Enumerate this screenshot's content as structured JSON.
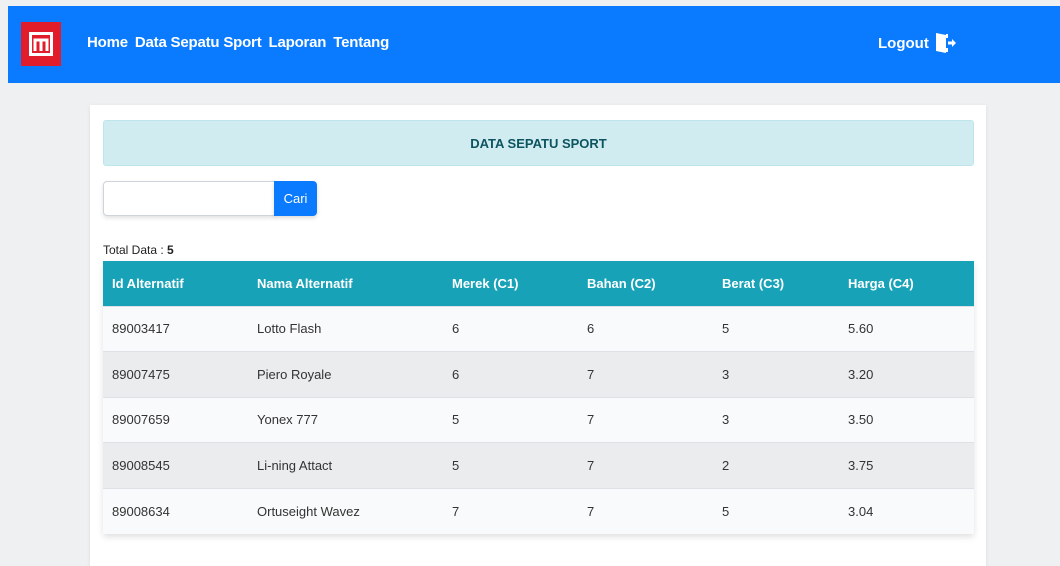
{
  "navbar": {
    "brand_icon": "m-logo-icon",
    "links": [
      "Home",
      "Data Sepatu Sport",
      "Laporan",
      "Tentang"
    ],
    "logout_label": "Logout",
    "logout_icon": "logout-door-icon",
    "color": "#0a7bff"
  },
  "main": {
    "alert_title": "DATA SEPATU SPORT",
    "search": {
      "value": "",
      "placeholder": "",
      "button_label": "Cari"
    },
    "total_label": "Total Data :",
    "total_value": "5"
  },
  "table": {
    "headers": [
      "Id Alternatif",
      "Nama Alternatif",
      "Merek (C1)",
      "Bahan (C2)",
      "Berat (C3)",
      "Harga (C4)"
    ],
    "rows": [
      [
        "89003417",
        "Lotto Flash",
        "6",
        "6",
        "5",
        "5.60"
      ],
      [
        "89007475",
        "Piero Royale",
        "6",
        "7",
        "3",
        "3.20"
      ],
      [
        "89007659",
        "Yonex 777",
        "5",
        "7",
        "3",
        "3.50"
      ],
      [
        "89008545",
        "Li-ning Attact",
        "5",
        "7",
        "2",
        "3.75"
      ],
      [
        "89008634",
        "Ortuseight Wavez",
        "7",
        "7",
        "5",
        "3.04"
      ]
    ],
    "header_color": "#17a2b8"
  }
}
